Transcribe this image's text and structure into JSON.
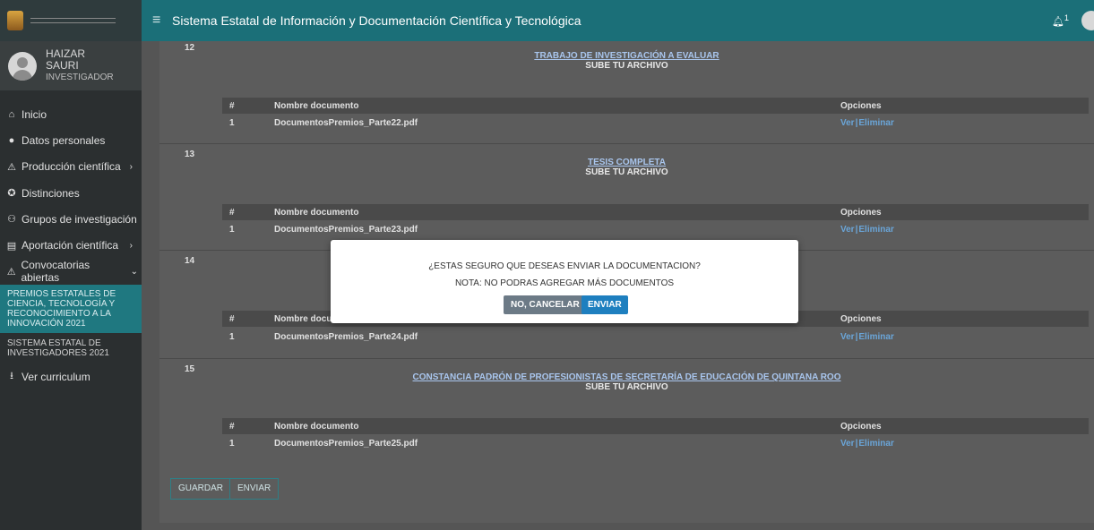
{
  "header": {
    "title": "Sistema Estatal de Información y Documentación Científica y Tecnológica",
    "notif_count": "1",
    "logo_icon": "coat-of-arms-logo"
  },
  "user": {
    "first": "HAIZAR",
    "last": "SAURI",
    "role": "INVESTIGADOR"
  },
  "nav": [
    {
      "icon": "home-icon",
      "glyph": "⌂",
      "label": "Inicio"
    },
    {
      "icon": "user-icon",
      "glyph": "●",
      "label": "Datos personales"
    },
    {
      "icon": "warning-icon",
      "glyph": "⚠",
      "label": "Producción científica",
      "chevron": "›"
    },
    {
      "icon": "award-icon",
      "glyph": "✪",
      "label": "Distinciones"
    },
    {
      "icon": "group-icon",
      "glyph": "⚇",
      "label": "Grupos de investigación"
    },
    {
      "icon": "book-icon",
      "glyph": "▤",
      "label": "Aportación científica",
      "chevron": "›"
    },
    {
      "icon": "warning-icon",
      "glyph": "⚠",
      "label": "Convocatorias abiertas",
      "chevron": "⌄"
    }
  ],
  "sub_active": "PREMIOS ESTATALES DE CIENCIA, TECNOLOGÍA Y RECONOCIMIENTO A LA INNOVACIÓN 2021",
  "sub_other": "SISTEMA ESTATAL DE INVESTIGADORES 2021",
  "nav_last": {
    "icon": "download-icon",
    "glyph": "⭳",
    "label": "Ver curriculum"
  },
  "table_head": {
    "num": "#",
    "name": "Nombre documento",
    "options": "Opciones"
  },
  "options": {
    "ver": "Ver",
    "sep": "|",
    "del": "Eliminar"
  },
  "rows": [
    {
      "num": "12",
      "title": "TRABAJO DE INVESTIGACIÓN A EVALUAR",
      "sub": "SUBE TU ARCHIVO",
      "item": "1",
      "file": "DocumentosPremios_Parte22.pdf"
    },
    {
      "num": "13",
      "title": "TESIS COMPLETA",
      "sub": "SUBE TU ARCHIVO",
      "item": "1",
      "file": "DocumentosPremios_Parte23.pdf"
    },
    {
      "num": "14",
      "title": "",
      "sub": "",
      "item": "1",
      "file": "DocumentosPremios_Parte24.pdf"
    },
    {
      "num": "15",
      "title": "CONSTANCIA PADRÓN DE PROFESIONISTAS DE SECRETARÍA DE EDUCACIÓN DE QUINTANA ROO",
      "sub": "SUBE TU ARCHIVO",
      "item": "1",
      "file": "DocumentosPremios_Parte25.pdf"
    }
  ],
  "buttons": {
    "save": "GUARDAR",
    "send": "ENVIAR"
  },
  "modal": {
    "question": "¿ESTAS SEGURO QUE DESEAS ENVIAR LA DOCUMENTACION?",
    "note": "NOTA: NO PODRAS AGREGAR MÁS DOCUMENTOS",
    "cancel": "NO, CANCELAR",
    "confirm": "ENVIAR"
  }
}
